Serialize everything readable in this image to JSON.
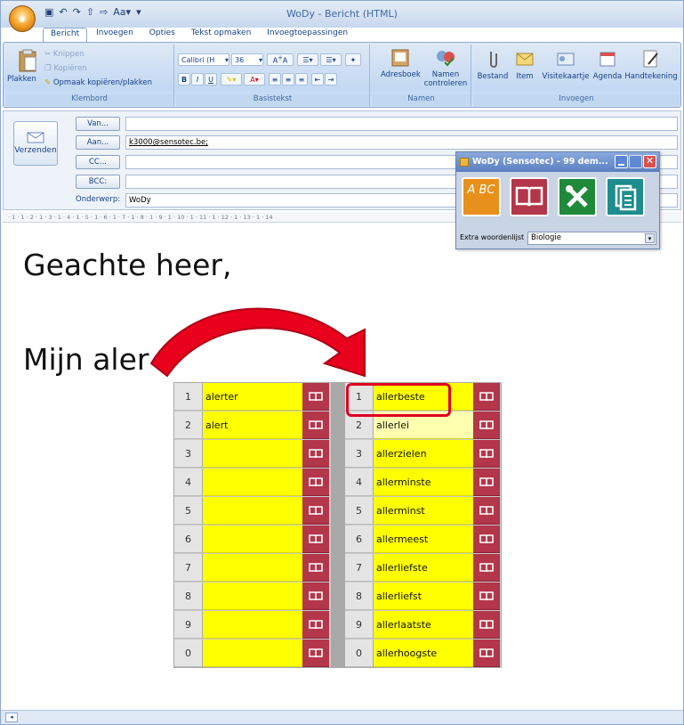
{
  "window": {
    "title": "WoDy - Bericht (HTML)",
    "office_button": "Oﬀ"
  },
  "tabs": [
    "Bericht",
    "Invoegen",
    "Opties",
    "Tekst opmaken",
    "Invoegtoepassingen"
  ],
  "ribbon": {
    "klembord": {
      "caption": "Klembord",
      "plakken": "Plakken",
      "knippen": "Knippen",
      "kopieren": "Kopiëren",
      "opmaak": "Opmaak kopiëren/plakken"
    },
    "basistekst": {
      "caption": "Basistekst",
      "font": "Calibri (H",
      "size": "36"
    },
    "namen": {
      "caption": "Namen",
      "adresboek": "Adresboek",
      "controleren_1": "Namen",
      "controleren_2": "controleren"
    },
    "invoegen": {
      "caption": "Invoegen",
      "items": [
        "Bestand",
        "Item",
        "Visitekaartje",
        "Agenda",
        "Handtekening"
      ]
    }
  },
  "header": {
    "send_label": "Verzenden",
    "van_label": "Van...",
    "aan_label": "Aan...",
    "cc_label": "CC...",
    "bcc_label": "BCC:",
    "subject_label": "Onderwerp:",
    "aan_value": "k3000@sensotec.be;",
    "van_value": "",
    "cc_value": "",
    "bcc_value": "",
    "subject_value": "WoDy"
  },
  "ruler_text": "· 1 · 1 · 2 · 1 · 3 · 1 · 4 · 1 · 5 · 1 · 6 · 1 · 7 · 1 · 8 · 1 · 9 · 1 · 10 · 1 · 11 · 1 · 12 · 1 · 13 · 1 · 14",
  "body": {
    "greeting": "Geachte heer,",
    "text": "Mijn aler"
  },
  "wody": {
    "title": "WoDy (Sensotec) - 99 dem...",
    "tile_abc": "A BC",
    "extra_label": "Extra woordenlijst",
    "extra_value": "Biologie",
    "colors": {
      "abc": "#e8901c",
      "book": "#b3364a",
      "tools": "#1f8a3a",
      "docs": "#1e8d8d"
    }
  },
  "predictions": {
    "left": [
      {
        "num": "1",
        "word": "alerter"
      },
      {
        "num": "2",
        "word": "alert"
      },
      {
        "num": "3",
        "word": ""
      },
      {
        "num": "4",
        "word": ""
      },
      {
        "num": "5",
        "word": ""
      },
      {
        "num": "6",
        "word": ""
      },
      {
        "num": "7",
        "word": ""
      },
      {
        "num": "8",
        "word": ""
      },
      {
        "num": "9",
        "word": ""
      },
      {
        "num": "0",
        "word": ""
      }
    ],
    "right": [
      {
        "num": "1",
        "word": "allerbeste"
      },
      {
        "num": "2",
        "word": "allerlei"
      },
      {
        "num": "3",
        "word": "allerzielen"
      },
      {
        "num": "4",
        "word": "allerminste"
      },
      {
        "num": "5",
        "word": "allerminst"
      },
      {
        "num": "6",
        "word": "allermeest"
      },
      {
        "num": "7",
        "word": "allerliefste"
      },
      {
        "num": "8",
        "word": "allerliefst"
      },
      {
        "num": "9",
        "word": "allerlaatste"
      },
      {
        "num": "0",
        "word": "allerhoogste"
      }
    ]
  }
}
